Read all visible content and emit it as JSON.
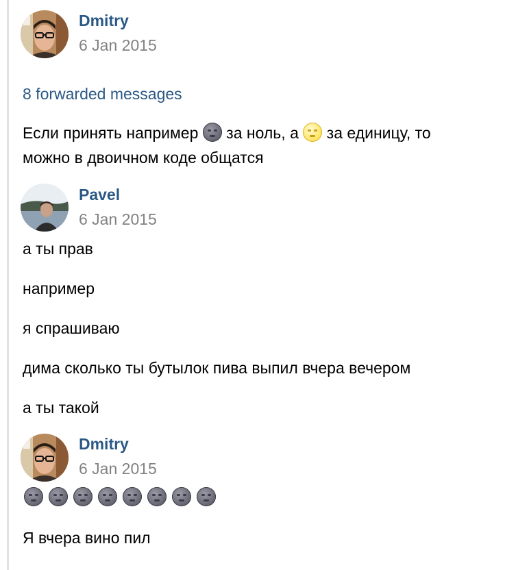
{
  "messages": [
    {
      "author": "Dmitry",
      "date": "6 Jan 2015",
      "forwarded_label": "8 forwarded messages",
      "text_part1": "Если принять например",
      "text_part2": "за ноль, а",
      "text_part3": "за единицу, то",
      "text_line2": "можно в двоичном коде общатся",
      "emoji_1": "new-moon-face-icon",
      "emoji_2": "full-moon-face-icon"
    },
    {
      "author": "Pavel",
      "date": "6 Jan 2015",
      "lines": [
        "а ты прав",
        "например",
        "я спрашиваю",
        "дима сколько ты бутылок пива выпил вчера вечером",
        "а ты такой"
      ]
    },
    {
      "author": "Dmitry",
      "date": "6 Jan 2015",
      "emoji_count": 8,
      "emoji": "new-moon-face-icon",
      "text": "Я вчера вино пил"
    }
  ],
  "colors": {
    "author": "#2a5885",
    "date": "#828282",
    "link": "#2a5885",
    "quote_bar": "#dfe3e8"
  }
}
